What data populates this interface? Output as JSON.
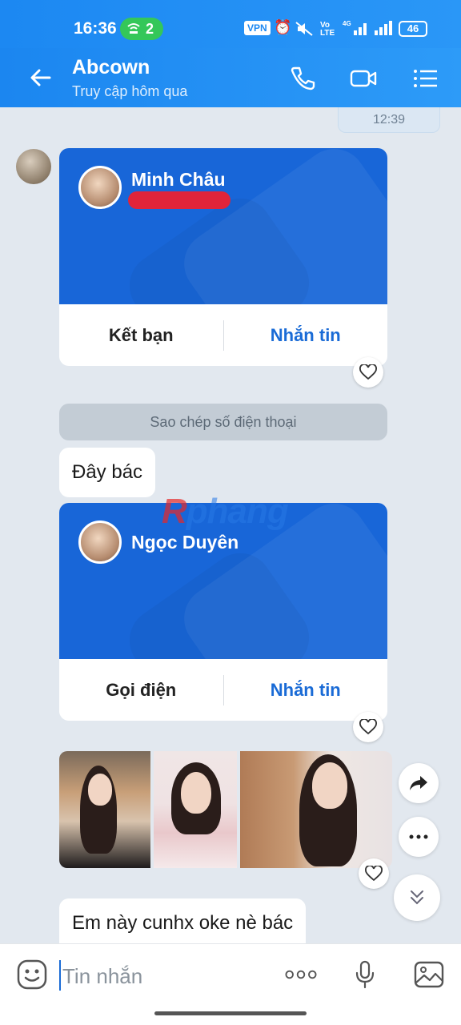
{
  "status_bar": {
    "time": "16:36",
    "hotspot_count": "2",
    "vpn": "VPN",
    "battery": "46"
  },
  "header": {
    "title": "Abcown",
    "subtitle": "Truy cập hôm qua"
  },
  "timestamp": "12:39",
  "cards": [
    {
      "name": "Minh Châu",
      "left_action": "Kết bạn",
      "right_action": "Nhắn tin"
    },
    {
      "name": "Ngọc Duyên",
      "left_action": "Gọi điện",
      "right_action": "Nhắn tin"
    }
  ],
  "system_pill": "Sao chép số điện thoại",
  "messages": {
    "first": "Đây bác",
    "second": "Em này cunhx oke nè bác"
  },
  "watermark": {
    "r": "R",
    "rest": "phang"
  },
  "input": {
    "placeholder": "Tin nhắn"
  },
  "colors": {
    "primary": "#1b86f0",
    "card_blue": "#1866d8",
    "action_blue": "#1a6bd6",
    "redaction": "#e0243a"
  }
}
